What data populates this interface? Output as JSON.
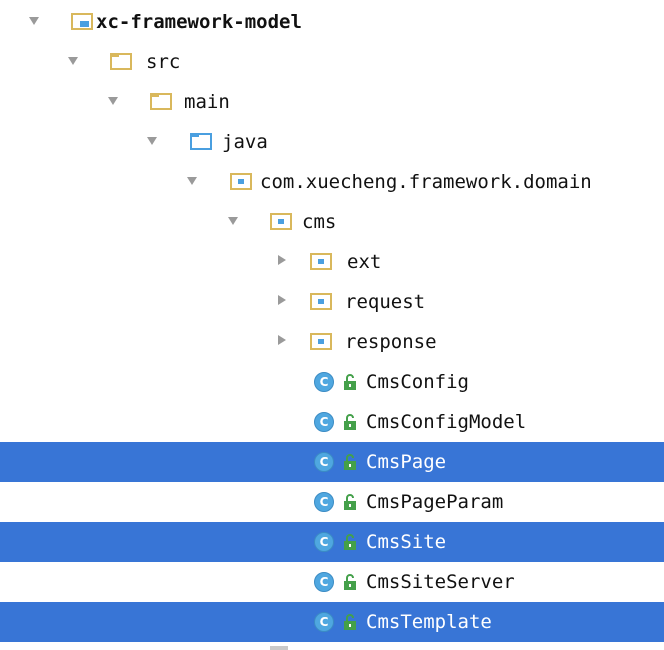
{
  "project_tree": {
    "root": {
      "label": "xc-framework-model",
      "expanded": true
    },
    "src": {
      "label": "src",
      "expanded": true
    },
    "main": {
      "label": "main",
      "expanded": true
    },
    "java": {
      "label": "java",
      "expanded": true
    },
    "domain_package": {
      "label": "com.xuecheng.framework.domain",
      "expanded": true
    },
    "cms_package": {
      "label": "cms",
      "expanded": true
    },
    "subpackages": [
      {
        "label": "ext",
        "expanded": false
      },
      {
        "label": "request",
        "expanded": false
      },
      {
        "label": "response",
        "expanded": false
      }
    ],
    "classes": [
      {
        "label": "CmsConfig",
        "selected": false
      },
      {
        "label": "CmsConfigModel",
        "selected": false
      },
      {
        "label": "CmsPage",
        "selected": true
      },
      {
        "label": "CmsPageParam",
        "selected": false
      },
      {
        "label": "CmsSite",
        "selected": true
      },
      {
        "label": "CmsSiteServer",
        "selected": false
      },
      {
        "label": "CmsTemplate",
        "selected": true
      }
    ],
    "class_icon_letter": "C",
    "colors": {
      "selection": "#3875d6",
      "folder": "#d9b85c",
      "source_folder": "#4a9fe0",
      "class_icon": "#4fa7e0",
      "lock_icon": "#44a04a"
    }
  }
}
